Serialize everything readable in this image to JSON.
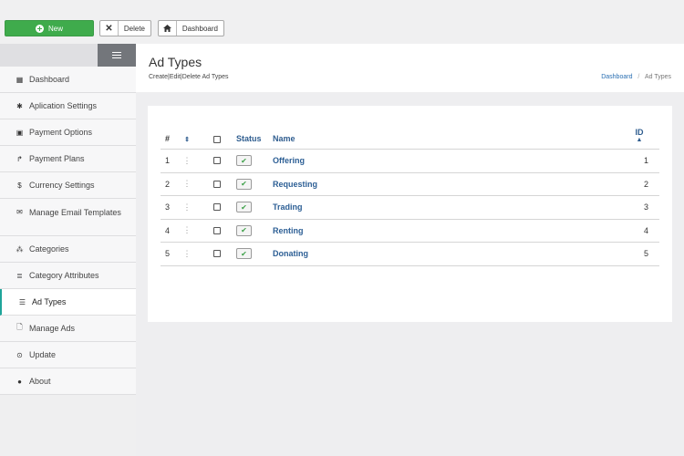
{
  "toolbar": {
    "new_label": "New",
    "delete_label": "Delete",
    "dashboard_label": "Dashboard"
  },
  "sidebar": {
    "items": [
      {
        "label": "Dashboard",
        "icon": "grid-icon"
      },
      {
        "label": "Aplication Settings",
        "icon": "gear-icon"
      },
      {
        "label": "Payment Options",
        "icon": "money-icon"
      },
      {
        "label": "Payment Plans",
        "icon": "level-up-icon"
      },
      {
        "label": "Currency Settings",
        "icon": "dollar-icon"
      },
      {
        "label": "Manage Email Templates",
        "icon": "envelope-icon"
      },
      {
        "label": "Categories",
        "icon": "sitemap-icon"
      },
      {
        "label": "Category Attributes",
        "icon": "database-icon"
      },
      {
        "label": "Ad Types",
        "icon": "list-icon",
        "active": true
      },
      {
        "label": "Manage Ads",
        "icon": "file-icon"
      },
      {
        "label": "Update",
        "icon": "circle-arrow-icon"
      },
      {
        "label": "About",
        "icon": "info-icon"
      }
    ]
  },
  "header": {
    "title": "Ad Types",
    "subtitle": "Create|Edit|Delete Ad Types",
    "breadcrumb": [
      "Dashboard",
      "Ad Types"
    ]
  },
  "table": {
    "columns": {
      "num": "#",
      "status": "Status",
      "name": "Name",
      "id": "ID"
    },
    "rows": [
      {
        "num": "1",
        "name": "Offering",
        "id": "1",
        "status": true
      },
      {
        "num": "2",
        "name": "Requesting",
        "id": "2",
        "status": true
      },
      {
        "num": "3",
        "name": "Trading",
        "id": "3",
        "status": true
      },
      {
        "num": "4",
        "name": "Renting",
        "id": "4",
        "status": true
      },
      {
        "num": "5",
        "name": "Donating",
        "id": "5",
        "status": true
      }
    ]
  },
  "colors": {
    "new_button": "#3fab4c",
    "active_accent": "#1fa59a",
    "link": "#2d5f95"
  }
}
